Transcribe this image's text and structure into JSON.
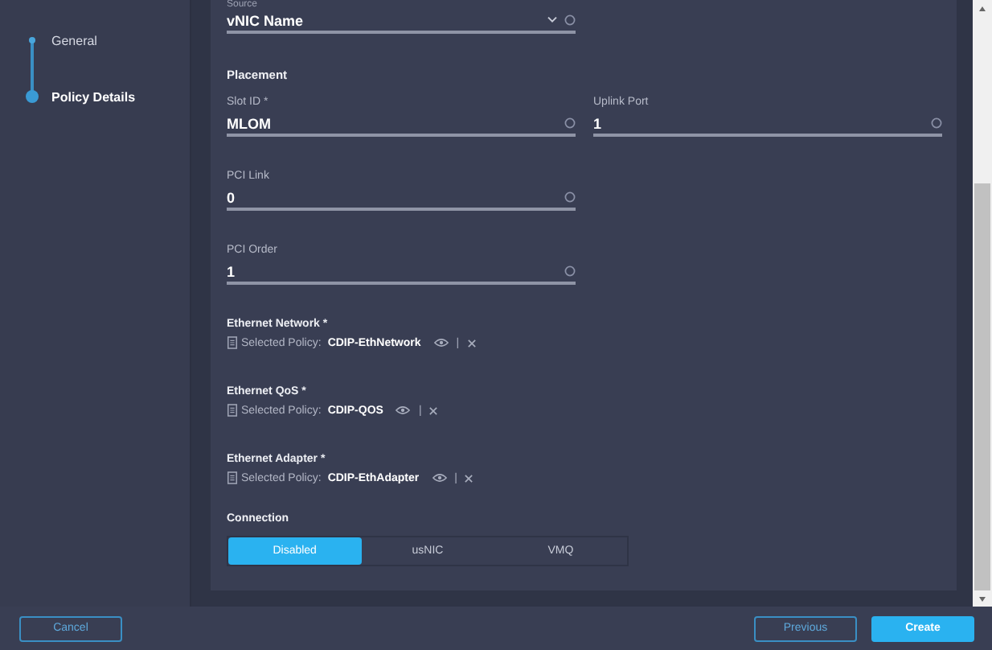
{
  "steps": [
    {
      "label": "General",
      "selected": false
    },
    {
      "label": "Policy Details",
      "selected": true
    }
  ],
  "source": {
    "label": "Source",
    "value": "vNIC Name"
  },
  "placement": {
    "heading": "Placement",
    "fields": [
      {
        "label": "Slot ID *",
        "value": "MLOM"
      },
      {
        "label": "Uplink Port",
        "value": "1"
      },
      {
        "label": "PCI Link",
        "value": "0"
      },
      {
        "label": "PCI Order",
        "value": "1"
      }
    ]
  },
  "policies": [
    {
      "label": "Ethernet Network *",
      "prefix": "Selected Policy:",
      "name": "CDIP-EthNetwork",
      "separator": "|"
    },
    {
      "label": "Ethernet QoS *",
      "prefix": "Selected Policy:",
      "name": "CDIP-QOS",
      "separator": "|"
    },
    {
      "label": "Ethernet Adapter *",
      "prefix": "Selected Policy:",
      "name": "CDIP-EthAdapter",
      "separator": "|"
    }
  ],
  "connection": {
    "label": "Connection",
    "options": [
      {
        "label": "Disabled",
        "selected": true
      },
      {
        "label": "usNIC",
        "selected": false
      },
      {
        "label": "VMQ",
        "selected": false
      }
    ]
  },
  "footer": {
    "cancel": "Cancel",
    "previous": "Previous",
    "create": "Create"
  }
}
